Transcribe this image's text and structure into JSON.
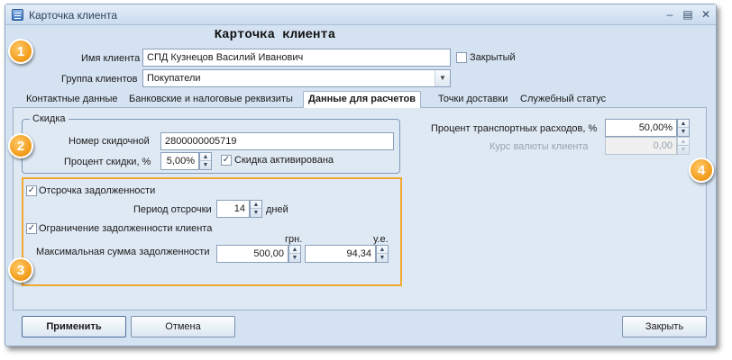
{
  "window": {
    "title": "Карточка клиента"
  },
  "header": {
    "title": "Карточка клиента"
  },
  "client": {
    "name_label": "Имя клиента",
    "name_value": "СПД Кузнецов Василий Иванович",
    "closed_label": "Закрытый",
    "closed_checked": false,
    "group_label": "Группа клиентов",
    "group_value": "Покупатели"
  },
  "tabs": [
    {
      "label": "Контактные данные",
      "active": false
    },
    {
      "label": "Банковские и налоговые реквизиты",
      "active": false
    },
    {
      "label": "Данные для расчетов",
      "active": true
    },
    {
      "label": "Точки доставки",
      "active": false
    },
    {
      "label": "Служебный статус",
      "active": false
    }
  ],
  "discount": {
    "group_title": "Скидка",
    "card_label": "Номер скидочной",
    "card_value": "2800000005719",
    "percent_label": "Процент скидки, %",
    "percent_value": "5,00%",
    "activated_label": "Скидка активирована",
    "activated_checked": true
  },
  "debt": {
    "deferral_label": "Отсрочка задолженности",
    "deferral_checked": true,
    "period_label": "Период отсрочки",
    "period_value": "14",
    "period_unit": "дней",
    "limit_label": "Ограничение задолженности клиента",
    "limit_checked": true,
    "max_label": "Максимальная сумма задолженности",
    "currency_uah": "грн.",
    "currency_ue": "у.е.",
    "max_uah_value": "500,00",
    "max_ue_value": "94,34"
  },
  "transport": {
    "percent_label": "Процент транспортных расходов, %",
    "percent_value": "50,00%",
    "rate_label": "Курс валюты клиента",
    "rate_value": "0,00"
  },
  "buttons": {
    "apply": "Применить",
    "cancel": "Отмена",
    "close": "Закрыть"
  },
  "badges": [
    "1",
    "2",
    "3",
    "4"
  ],
  "colors": {
    "badge": "#f29a18",
    "highlight_border": "#f0a830",
    "window_bg": "#d4e2f1"
  }
}
